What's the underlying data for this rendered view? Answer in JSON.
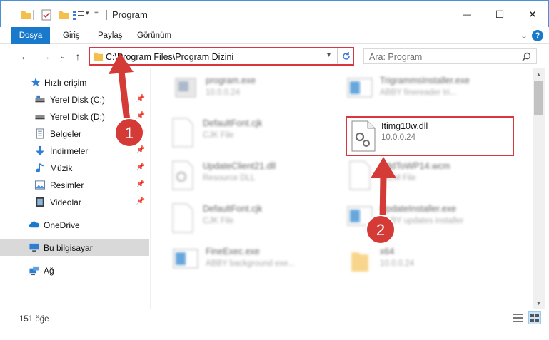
{
  "window": {
    "title": "Program",
    "minimize_glyph": "—",
    "maximize_glyph": "☐",
    "close_glyph": "✕"
  },
  "ribbon": {
    "tabs": [
      "Dosya",
      "Giriş",
      "Paylaş",
      "Görünüm"
    ],
    "expand_glyph": "⌄",
    "help_glyph": "?"
  },
  "address": {
    "path": "C:\\Program Files\\Program Dizini",
    "search_placeholder": "Ara: Program",
    "back_glyph": "←",
    "forward_glyph": "→",
    "recent_glyph": "⌄",
    "up_glyph": "↑"
  },
  "sidebar": {
    "items": [
      {
        "label": "Hızlı erişim",
        "icon": "star-icon"
      },
      {
        "label": "Yerel Disk (C:)",
        "icon": "drive-icon"
      },
      {
        "label": "Yerel Disk (D:)",
        "icon": "drive-icon"
      },
      {
        "label": "Belgeler",
        "icon": "documents-icon"
      },
      {
        "label": "İndirmeler",
        "icon": "download-icon"
      },
      {
        "label": "Müzik",
        "icon": "music-icon"
      },
      {
        "label": "Resimler",
        "icon": "pictures-icon"
      },
      {
        "label": "Videolar",
        "icon": "videos-icon"
      },
      {
        "label": "OneDrive",
        "icon": "cloud-icon"
      },
      {
        "label": "Bu bilgisayar",
        "icon": "computer-icon"
      },
      {
        "label": "Ağ",
        "icon": "network-icon"
      }
    ]
  },
  "files": [
    {
      "name": "program.exe",
      "desc": "10.0.0.24"
    },
    {
      "name": "TrigrammsInstaller.exe",
      "desc": "ABBY finereader tri..."
    },
    {
      "name": "DefaultFont.cjk",
      "desc": "CJK File"
    },
    {
      "name": "Itimg10w.dll",
      "desc": "10.0.0.24"
    },
    {
      "name": "UpdateClient21.dll",
      "desc": "Resource DLL"
    },
    {
      "name": "AddToWP14.wcm",
      "desc": "WCM File"
    },
    {
      "name": "DefaultFont.cjk",
      "desc": "CJK File"
    },
    {
      "name": "UpdateInstaller.exe",
      "desc": "ABBY updates installer"
    },
    {
      "name": "FineExec.exe",
      "desc": "ABBY background exe..."
    },
    {
      "name": "x64",
      "desc": "10.0.0.24"
    }
  ],
  "status": {
    "item_count": "151 öğe"
  },
  "annotations": {
    "step1": "1",
    "step2": "2"
  },
  "colors": {
    "accent": "#1979ca",
    "highlight_red": "#d9363e",
    "badge_red": "#d43a36"
  }
}
